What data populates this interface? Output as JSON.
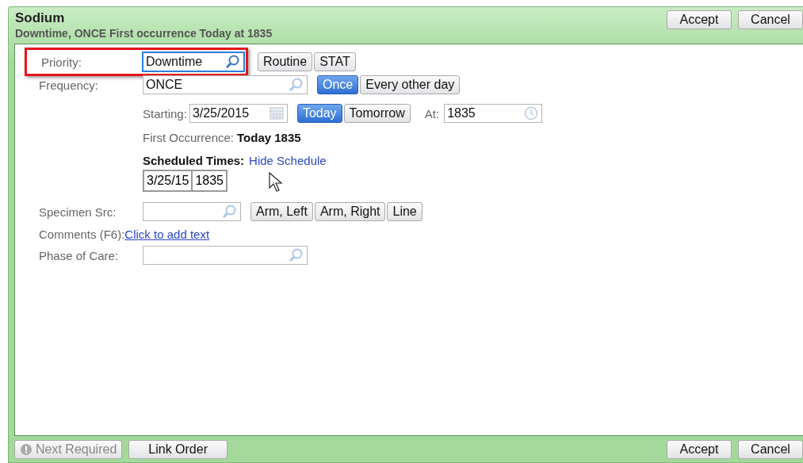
{
  "window": {
    "title": "Sodium",
    "subtitle": "Downtime, ONCE First occurrence Today at 1835"
  },
  "header_buttons": [
    {
      "label": "Accept"
    },
    {
      "label": "Cancel"
    }
  ],
  "priority": {
    "label": "Priority:",
    "value": "Downtime",
    "focused": true,
    "highlighted": true,
    "options": [
      {
        "label": "Routine",
        "selected": false
      },
      {
        "label": "STAT",
        "selected": false
      }
    ]
  },
  "frequency": {
    "label": "Frequency:",
    "value": "ONCE",
    "focused": false,
    "options": [
      {
        "label": "Once",
        "selected": true
      },
      {
        "label": "Every other day",
        "selected": false
      }
    ]
  },
  "schedule": {
    "starting_label": "Starting:",
    "date": "3/25/2015",
    "day_options": [
      {
        "label": "Today",
        "selected": true
      },
      {
        "label": "Tomorrow",
        "selected": false
      }
    ],
    "at_label": "At:",
    "time": "1835",
    "first_occurrence_label": "First Occurrence:",
    "first_occurrence_value": "Today 1835",
    "times_label": "Scheduled Times:",
    "hide_link": "Hide Schedule",
    "times": [
      [
        "3/25/15",
        "1835"
      ]
    ]
  },
  "specimen": {
    "label": "Specimen Src:",
    "focused": false,
    "options": [
      {
        "label": "Arm, Left",
        "selected": false
      },
      {
        "label": "Arm, Right",
        "selected": false
      },
      {
        "label": "Line",
        "selected": false
      }
    ]
  },
  "comments": {
    "label": "Comments (F6):",
    "link": "Click to add text"
  },
  "phase": {
    "label": "Phase of Care:",
    "focused": false
  },
  "footer": {
    "next_required": {
      "label": "Next Required",
      "disabled": true
    },
    "link_order": "Link Order",
    "buttons": [
      {
        "label": "Accept"
      },
      {
        "label": "Cancel"
      }
    ]
  }
}
